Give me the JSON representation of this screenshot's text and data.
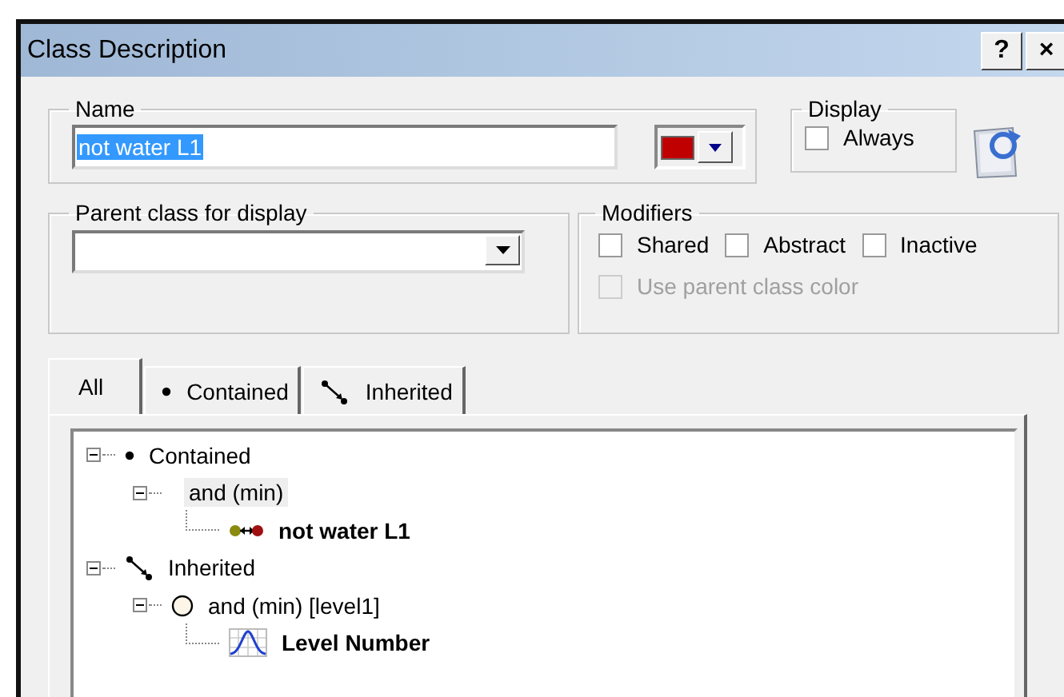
{
  "window": {
    "title": "Class Description",
    "help_button": "?",
    "close_button": "×"
  },
  "name_group": {
    "label": "Name",
    "value": "not water L1",
    "color": "#c00000"
  },
  "display_group": {
    "label": "Display",
    "checkboxes": [
      {
        "label": "Always",
        "checked": false,
        "disabled": false
      }
    ]
  },
  "parent_group": {
    "label": "Parent class for display"
  },
  "modifiers_group": {
    "label": "Modifiers",
    "checkboxes": [
      {
        "label": "Shared",
        "checked": false,
        "disabled": false
      },
      {
        "label": "Abstract",
        "checked": false,
        "disabled": false
      },
      {
        "label": "Inactive",
        "checked": false,
        "disabled": false
      },
      {
        "label": "Use parent class color",
        "checked": false,
        "disabled": true
      }
    ]
  },
  "tabs": [
    {
      "label": "All",
      "kind": "plain",
      "selected": true
    },
    {
      "label": "Contained",
      "kind": "dot",
      "selected": false
    },
    {
      "label": "Inherited",
      "kind": "inherit",
      "selected": false
    }
  ],
  "tree": [
    {
      "label": "Contained",
      "kind": "dot",
      "expanded": true,
      "selected": false,
      "children": [
        {
          "label": "and (min)",
          "kind": "blank",
          "expanded": true,
          "selected": true,
          "children": [
            {
              "label": "not water L1",
              "kind": "link",
              "selected": false
            }
          ]
        }
      ]
    },
    {
      "label": "Inherited",
      "kind": "inherit",
      "expanded": true,
      "selected": false,
      "children": [
        {
          "label": "and (min) [level1]",
          "kind": "circle",
          "expanded": true,
          "selected": false,
          "children": [
            {
              "label": "Level Number",
              "kind": "curve",
              "selected": false
            }
          ]
        }
      ]
    }
  ]
}
